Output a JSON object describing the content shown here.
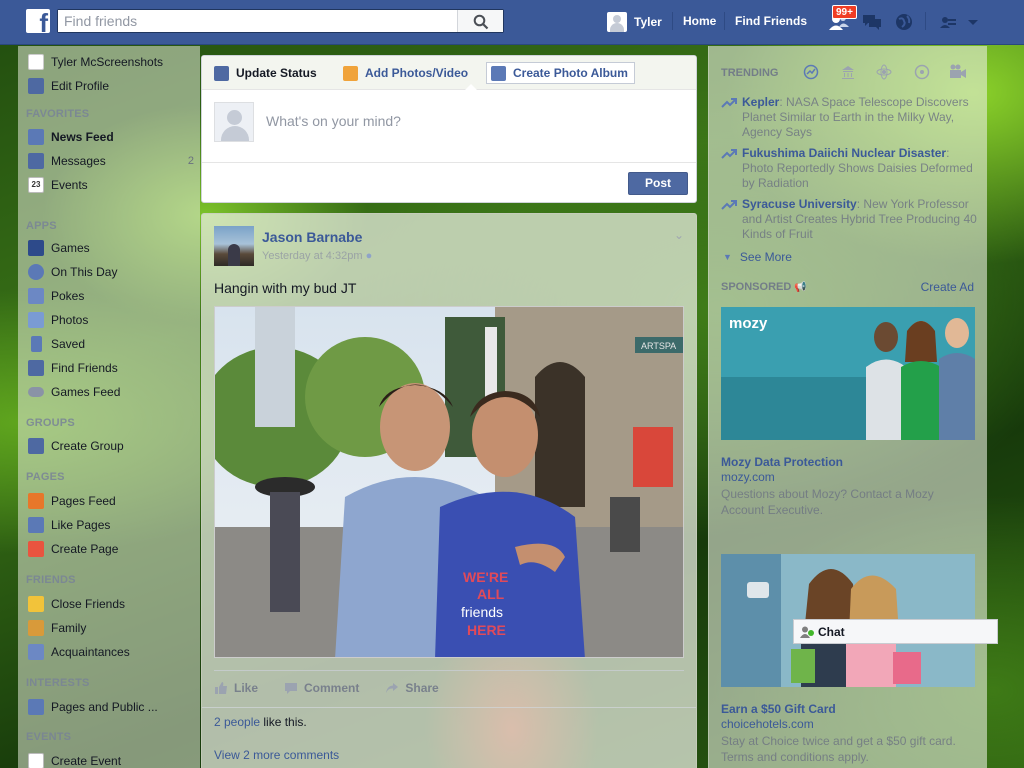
{
  "topbar": {
    "logo": "f",
    "search_placeholder": "Find friends",
    "user_name": "Tyler",
    "home_label": "Home",
    "find_friends_label": "Find Friends",
    "friend_requests_badge": "99+",
    "brand_color": "#3b5998"
  },
  "sidebar": {
    "profile_name": "Tyler McScreenshots",
    "edit_profile": "Edit Profile",
    "favorites_heading": "FAVORITES",
    "favorites": [
      {
        "label": "News Feed",
        "icon": "news-feed-icon"
      },
      {
        "label": "Messages",
        "count": "2",
        "icon": "messages-icon"
      },
      {
        "label": "Events",
        "icon": "events-calendar-icon",
        "icon_text": "23"
      }
    ],
    "apps_heading": "APPS",
    "apps": [
      {
        "label": "Games",
        "icon": "games-icon"
      },
      {
        "label": "On This Day",
        "icon": "on-this-day-icon"
      },
      {
        "label": "Pokes",
        "icon": "pokes-icon"
      },
      {
        "label": "Photos",
        "icon": "photos-icon"
      },
      {
        "label": "Saved",
        "icon": "saved-bookmark-icon"
      },
      {
        "label": "Find Friends",
        "icon": "find-friends-icon"
      },
      {
        "label": "Games Feed",
        "icon": "games-feed-controller-icon"
      }
    ],
    "groups_heading": "GROUPS",
    "groups": [
      {
        "label": "Create Group",
        "icon": "create-group-icon"
      }
    ],
    "pages_heading": "PAGES",
    "pages": [
      {
        "label": "Pages Feed",
        "icon": "pages-feed-megaphone-icon"
      },
      {
        "label": "Like Pages",
        "icon": "like-pages-thumb-icon"
      },
      {
        "label": "Create Page",
        "icon": "create-page-icon"
      }
    ],
    "friends_heading": "FRIENDS",
    "friends": [
      {
        "label": "Close Friends",
        "icon": "close-friends-star-icon"
      },
      {
        "label": "Family",
        "icon": "family-icon"
      },
      {
        "label": "Acquaintances",
        "icon": "acquaintances-icon"
      }
    ],
    "interests_heading": "INTERESTS",
    "interests": [
      {
        "label": "Pages and Public ...",
        "icon": "interests-icon"
      }
    ],
    "events_heading": "EVENTS",
    "events": [
      {
        "label": "Create Event",
        "icon": "create-event-icon"
      }
    ]
  },
  "composer": {
    "tabs": [
      {
        "label": "Update Status",
        "icon": "pencil-icon"
      },
      {
        "label": "Add Photos/Video",
        "icon": "photo-icon"
      },
      {
        "label": "Create Photo Album",
        "icon": "album-icon"
      }
    ],
    "placeholder": "What's on your mind?",
    "post_label": "Post"
  },
  "story": {
    "author": "Jason Barnabe",
    "timestamp": "Yesterday at 4:32pm",
    "text": "Hangin with my bud JT",
    "photo_shirt_text": [
      "WE'RE",
      "ALL",
      "friends",
      "HERE"
    ],
    "photo_sign_text": "ARTSPA",
    "actions": [
      "Like",
      "Comment",
      "Share"
    ],
    "likes_link": "2 people",
    "likes_suffix": " like this.",
    "more_comments": "View 2 more comments"
  },
  "right": {
    "trending_heading": "TRENDING",
    "trends": [
      {
        "topic": "Kepler",
        "text": ": NASA Space Telescope Discovers Planet Similar to Earth in the Milky Way, Agency Says"
      },
      {
        "topic": "Fukushima Daiichi Nuclear Disaster",
        "text": ": Photo Reportedly Shows Daisies Deformed by Radiation"
      },
      {
        "topic": "Syracuse University",
        "text": ": New York Professor and Artist Creates Hybrid Tree Producing 40 Kinds of Fruit"
      }
    ],
    "see_more": "See More",
    "sponsored_heading": "SPONSORED",
    "create_ad": "Create Ad",
    "ads": [
      {
        "logo_text": "mozy",
        "title": "Mozy Data Protection",
        "domain": "mozy.com",
        "body": "Questions about Mozy? Contact a Mozy Account Executive."
      },
      {
        "title": "Earn a $50 Gift Card",
        "domain": "choicehotels.com",
        "body": "Stay at Choice twice and get a $50 gift card. Terms and conditions apply."
      }
    ]
  },
  "chat": {
    "label": "Chat"
  }
}
